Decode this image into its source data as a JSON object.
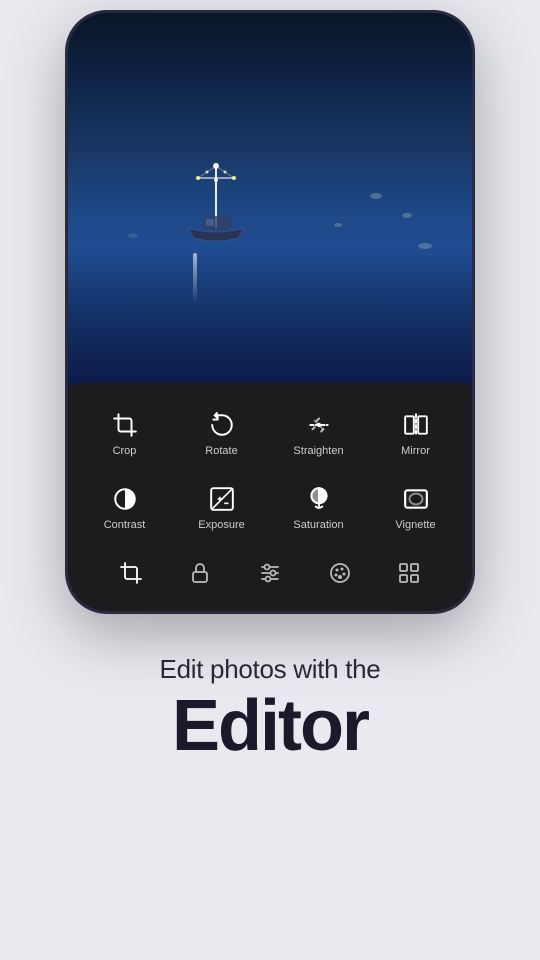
{
  "page": {
    "background_color": "#e8eaf0"
  },
  "phone": {
    "frame_color": "#1a1a2e",
    "border_color": "#2a2a3e"
  },
  "toolbar": {
    "background": "#1c1c1e",
    "tools_row1": [
      {
        "id": "crop",
        "label": "Crop",
        "icon": "crop-icon"
      },
      {
        "id": "rotate",
        "label": "Rotate",
        "icon": "rotate-icon"
      },
      {
        "id": "straighten",
        "label": "Straighten",
        "icon": "straighten-icon"
      },
      {
        "id": "mirror",
        "label": "Mirror",
        "icon": "mirror-icon"
      }
    ],
    "tools_row2": [
      {
        "id": "contrast",
        "label": "Contrast",
        "icon": "contrast-icon"
      },
      {
        "id": "exposure",
        "label": "Exposure",
        "icon": "exposure-icon"
      },
      {
        "id": "saturation",
        "label": "Saturation",
        "icon": "saturation-icon"
      },
      {
        "id": "vignette",
        "label": "Vignette",
        "icon": "vignette-icon"
      }
    ],
    "nav_icons": [
      "crop-nav",
      "lock-nav",
      "sliders-nav",
      "palette-nav",
      "grid-nav"
    ]
  },
  "bottom_text": {
    "subtitle": "Edit photos with the",
    "main_title": "Editor"
  }
}
